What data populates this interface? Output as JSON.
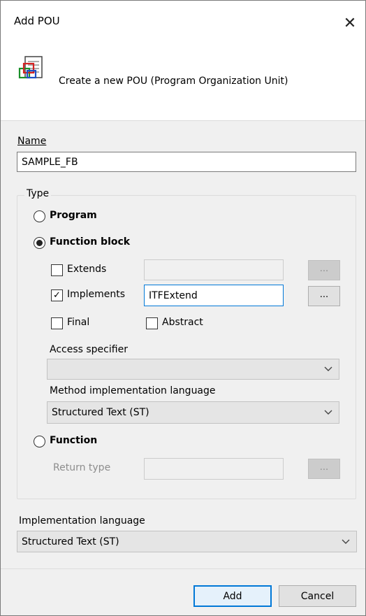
{
  "window": {
    "title": "Add POU"
  },
  "header": {
    "description": "Create a new POU (Program Organization Unit)"
  },
  "name": {
    "label": "Name",
    "value": "SAMPLE_FB"
  },
  "type": {
    "legend": "Type",
    "program_label": "Program",
    "function_block_label": "Function block",
    "function_label": "Function",
    "selected": "Function block"
  },
  "function_block": {
    "extends_label": "Extends",
    "extends_checked": false,
    "extends_value": "",
    "implements_label": "Implements",
    "implements_checked": true,
    "implements_value": "ITFExtend",
    "final_label": "Final",
    "final_checked": false,
    "abstract_label": "Abstract",
    "abstract_checked": false,
    "browse_label": "...",
    "access_specifier_label": "Access specifier",
    "access_specifier_value": "",
    "method_lang_label": "Method implementation language",
    "method_lang_value": "Structured Text (ST)"
  },
  "function": {
    "return_type_label": "Return type",
    "return_type_value": ""
  },
  "implementation_language": {
    "label": "Implementation language",
    "value": "Structured Text (ST)"
  },
  "buttons": {
    "add": "Add",
    "cancel": "Cancel"
  },
  "icons": {
    "close": "close-icon",
    "pou": "pou-icon",
    "dropdown": "chevron-down-icon"
  },
  "colors": {
    "focus_border": "#0078d7",
    "dialog_bg": "#f0f0f0"
  }
}
